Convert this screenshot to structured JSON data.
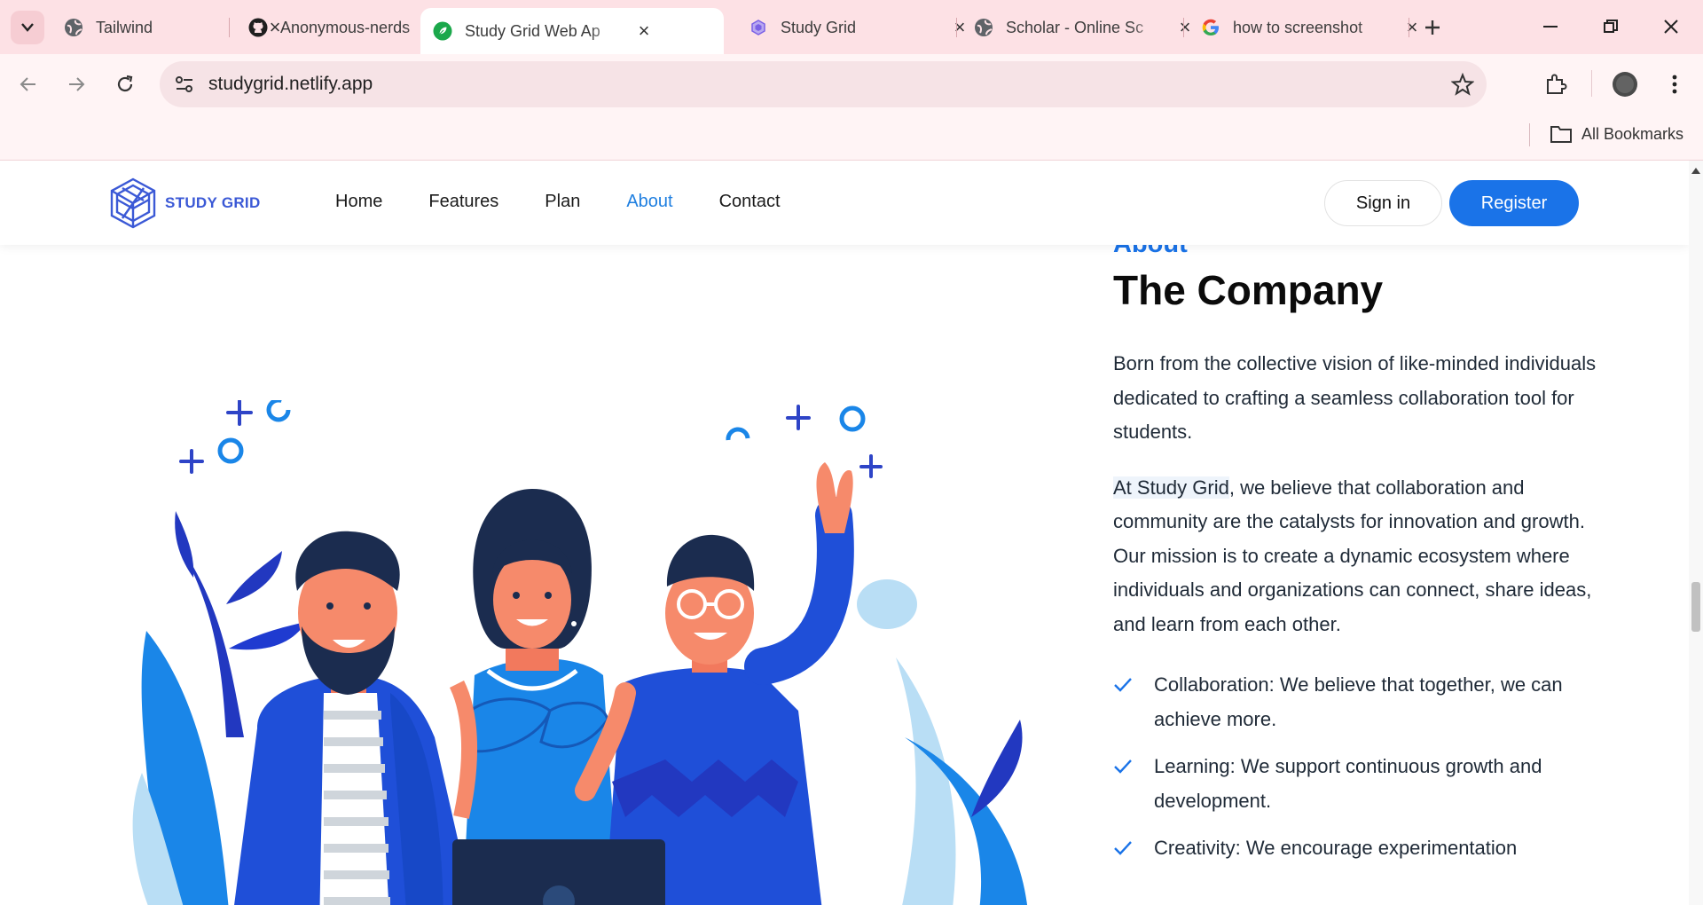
{
  "browser": {
    "tabs": [
      {
        "title": "Tailwind",
        "icon": "globe-icon",
        "active": false
      },
      {
        "title": "Anonymous-nerds",
        "icon": "github-icon",
        "active": false
      },
      {
        "title": "Study Grid Web Ap",
        "icon": "leaf-icon",
        "active": true
      },
      {
        "title": "Study Grid",
        "icon": "hexagon-icon",
        "active": false
      },
      {
        "title": "Scholar - Online Sc",
        "icon": "globe-icon",
        "active": false
      },
      {
        "title": "how to screenshot",
        "icon": "google-icon",
        "active": false
      }
    ],
    "url": "studygrid.netlify.app",
    "bookmarks_label": "All Bookmarks"
  },
  "site": {
    "brand": "STUDY GRID",
    "nav": [
      "Home",
      "Features",
      "Plan",
      "About",
      "Contact"
    ],
    "active_nav": "About",
    "sign_in": "Sign in",
    "register": "Register",
    "accent": "#1a73e8"
  },
  "about": {
    "eyebrow": "About",
    "headline": "The Company",
    "paragraph1": "Born from the collective vision of like-minded individuals dedicated to crafting a seamless collaboration tool for students.",
    "paragraph2_highlight": "At Study Grid",
    "paragraph2_rest": ", we believe that collaboration and community are the catalysts for innovation and growth. Our mission is to create a dynamic ecosystem where individuals and organizations can connect, share ideas, and learn from each other.",
    "values": [
      "Collaboration: We believe that together, we can achieve more.",
      "Learning: We support continuous growth and development.",
      "Creativity: We encourage experimentation"
    ]
  }
}
